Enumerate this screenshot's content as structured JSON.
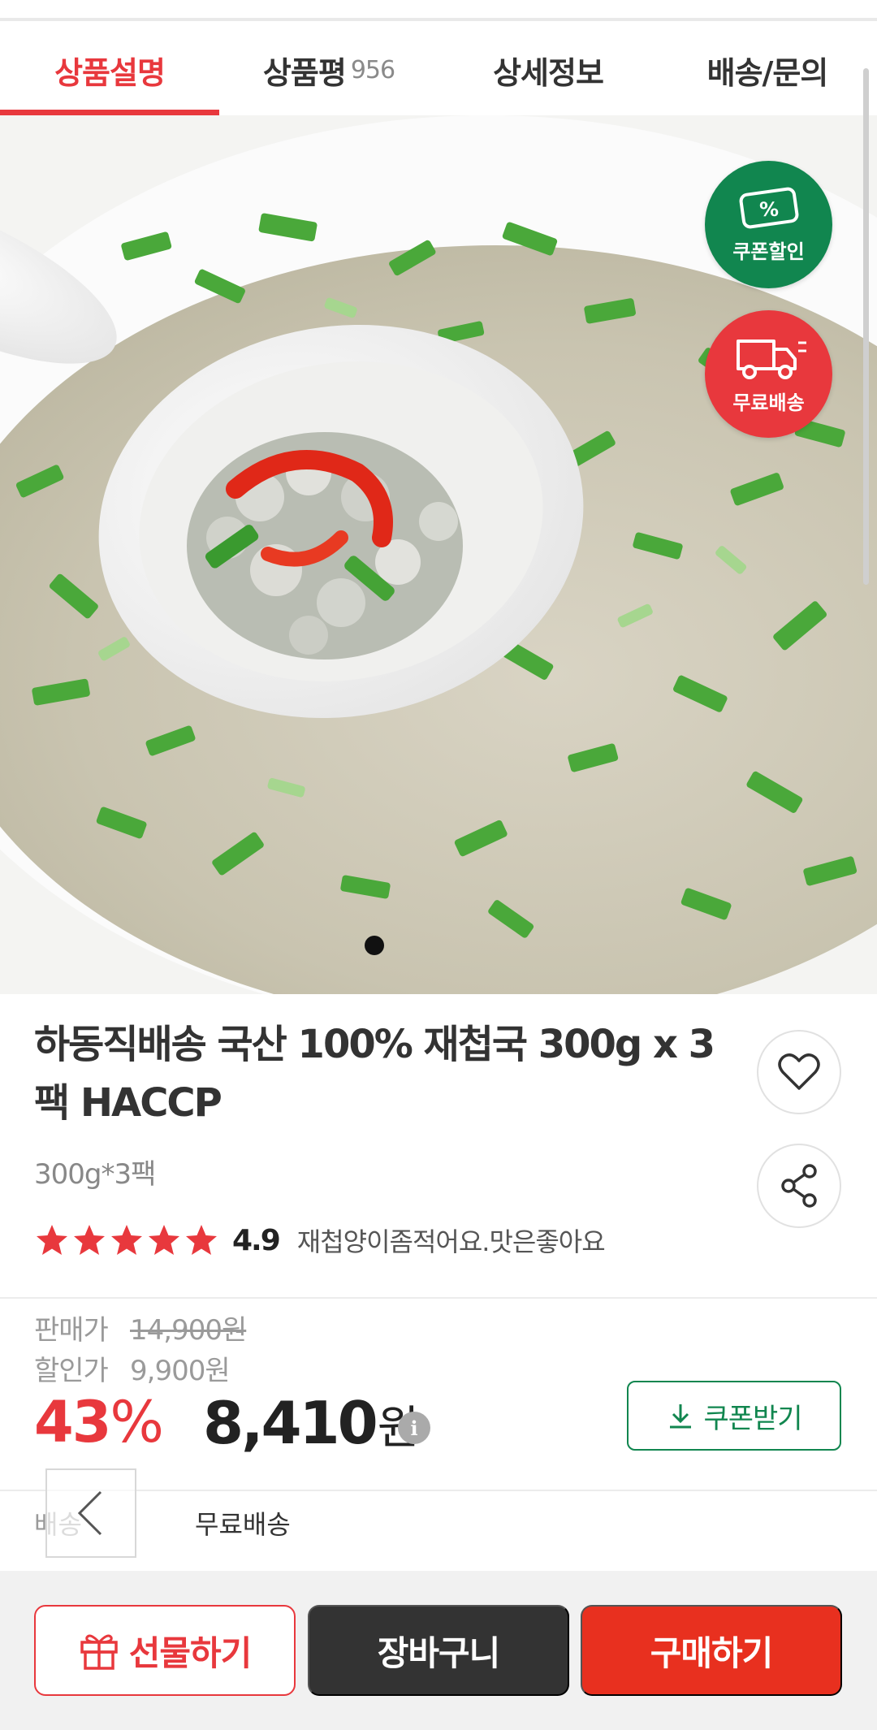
{
  "tabs": [
    {
      "label": "상품설명",
      "active": true
    },
    {
      "label": "상품평",
      "count": "956"
    },
    {
      "label": "상세정보"
    },
    {
      "label": "배송/문의"
    }
  ],
  "badges": {
    "coupon_label": "쿠폰할인",
    "coupon_icon_text": "%",
    "shipping_label": "무료배송"
  },
  "product": {
    "title": "하동직배송 국산 100% 재첩국 300g x 3팩 HACCP",
    "option": "300g*3팩",
    "rating": "4.9",
    "stars": 5,
    "review_snippet": "재첩양이좀적어요.맛은좋아요"
  },
  "price": {
    "sale_label": "판매가",
    "sale_price": "14,900원",
    "discount_label": "할인가",
    "discount_price": "9,900원",
    "discount_percent": "43",
    "percent_sign": "%",
    "final_price": "8,410",
    "won": "원",
    "info_icon_text": "i",
    "coupon_button": "쿠폰받기"
  },
  "shipping": {
    "label": "배송",
    "value": "무료배송"
  },
  "bottom_bar": {
    "gift": "선물하기",
    "cart": "장바구니",
    "buy": "구매하기"
  },
  "colors": {
    "accent_red": "#e8383d",
    "coupon_green": "#11864f",
    "dark_button": "#333333"
  }
}
